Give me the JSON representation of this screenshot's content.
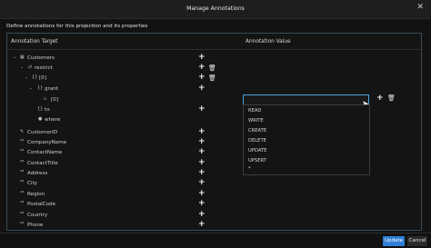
{
  "window": {
    "title": "Manage Annotations",
    "close_glyph": "✕"
  },
  "subtitle": "Define annotations for this projection and its properties",
  "table": {
    "col_target": "Annotation Target",
    "col_value": "Annotation Value"
  },
  "icons": {
    "entity": "▦",
    "relation": "⇄",
    "object": "{}",
    "item": "▫",
    "expand": "⌄",
    "collapse": "›",
    "field": "✎",
    "text_field": "ᴬᴮ",
    "add": "+",
    "delete": "🗑"
  },
  "tree": {
    "customers": "Customers",
    "restrict": "restrict",
    "idx0": "[0]",
    "grant": "grant",
    "grant_idx0": "[0]",
    "to": "to",
    "where": "where",
    "fields": [
      "CustomerID",
      "CompanyName",
      "ContactName",
      "ContactTitle",
      "Address",
      "City",
      "Region",
      "PostalCode",
      "Country",
      "Phone"
    ]
  },
  "value_input": {
    "value": ""
  },
  "dropdown": {
    "options": [
      "READ",
      "WRITE",
      "CREATE",
      "DELETE",
      "UPDATE",
      "UPSERT",
      "*"
    ]
  },
  "footer": {
    "update": "Update",
    "cancel": "Cancel"
  }
}
